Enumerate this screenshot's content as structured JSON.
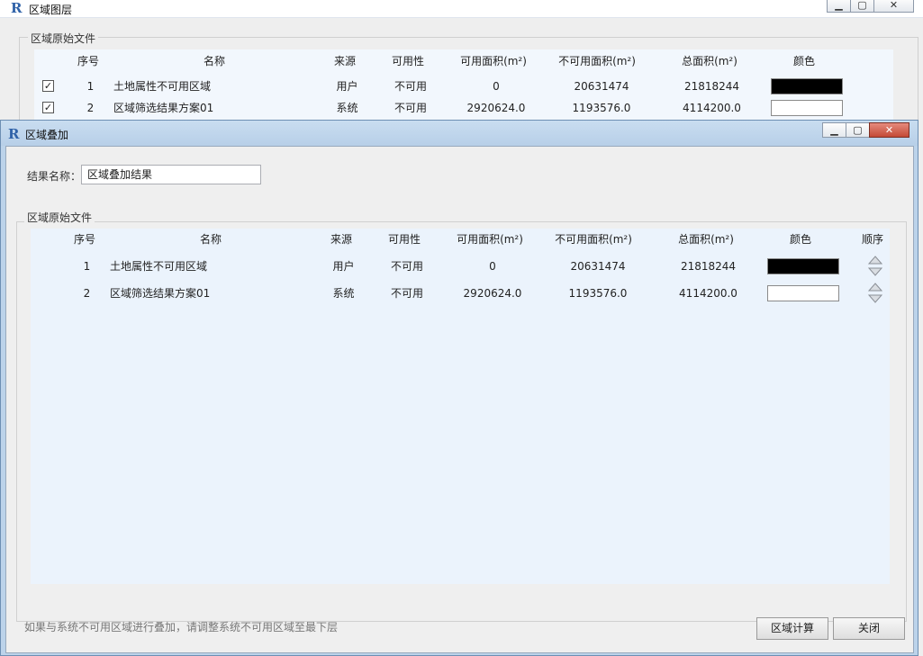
{
  "background_window": {
    "title": "区域图层",
    "group_title": "区域原始文件",
    "columns": [
      "序号",
      "名称",
      "来源",
      "可用性",
      "可用面积(m²)",
      "不可用面积(m²)",
      "总面积(m²)",
      "颜色"
    ],
    "rows": [
      {
        "checked": true,
        "index": "1",
        "name": "土地属性不可用区域",
        "source": "用户",
        "availability": "不可用",
        "available_area": "0",
        "unavailable_area": "20631474",
        "total_area": "21818244",
        "color": "#000000"
      },
      {
        "checked": true,
        "index": "2",
        "name": "区域筛选结果方案01",
        "source": "系统",
        "availability": "不可用",
        "available_area": "2920624.0",
        "unavailable_area": "1193576.0",
        "total_area": "4114200.0",
        "color": "#ffffff"
      }
    ]
  },
  "dialog": {
    "title": "区域叠加",
    "result_name_label": "结果名称：",
    "result_name_value": "区域叠加结果",
    "group_title": "区域原始文件",
    "columns": [
      "序号",
      "名称",
      "来源",
      "可用性",
      "可用面积(m²)",
      "不可用面积(m²)",
      "总面积(m²)",
      "颜色",
      "顺序"
    ],
    "rows": [
      {
        "index": "1",
        "name": "土地属性不可用区域",
        "source": "用户",
        "availability": "不可用",
        "available_area": "0",
        "unavailable_area": "20631474",
        "total_area": "21818244",
        "color": "#000000"
      },
      {
        "index": "2",
        "name": "区域筛选结果方案01",
        "source": "系统",
        "availability": "不可用",
        "available_area": "2920624.0",
        "unavailable_area": "1193576.0",
        "total_area": "4114200.0",
        "color": "#ffffff"
      }
    ],
    "hint": "如果与系统不可用区域进行叠加，请调整系统不可用区域至最下层",
    "calculate_button": "区域计算",
    "close_button": "关闭"
  },
  "icons": {
    "app_logo": "revit-logo-icon",
    "minimize": "minimize-icon",
    "maximize": "maximize-icon",
    "close": "close-icon",
    "move_up": "triangle-up-icon",
    "move_down": "triangle-down-icon"
  },
  "colors": {
    "list_background": "#ebf3fc",
    "titlebar_active": "#bcd3ea",
    "accent": "#2f62a8"
  }
}
